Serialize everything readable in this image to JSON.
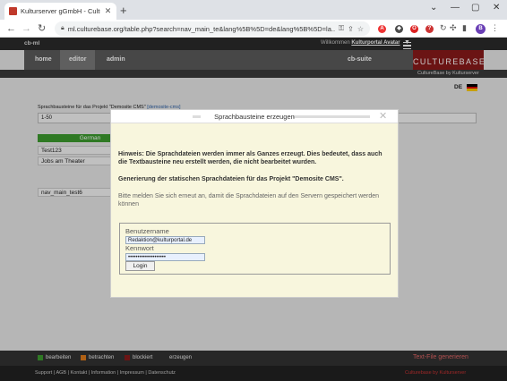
{
  "browser": {
    "tab_title": "Kulturserver gGmbH - Culturebase",
    "tab_close": "✕",
    "new_tab": "+",
    "window_controls": [
      "⌄",
      "—",
      "▢",
      "✕"
    ],
    "nav": {
      "back": "←",
      "forward": "→",
      "reload": "↻"
    },
    "url": "ml.culturebase.org/table.php?search=nav_main_te&lang%5B%5D=de&lang%5B%5D=la...",
    "profile_initial": "B"
  },
  "header": {
    "app_name": "cb-ml",
    "welcome": "Willkommen",
    "user": "Kulturportal Avatar",
    "menu": [
      "home",
      "editor",
      "admin"
    ],
    "suite": "cb-suite",
    "brand": "CULTUREBASE",
    "brand_sub": "CultureBase by Kulturserver",
    "language": "DE",
    "flag_colors": [
      "#000000",
      "#dd0000",
      "#ffce00"
    ]
  },
  "main": {
    "project_title": "Sprachbausteine für das Projekt \"Demosite CMS\"",
    "project_code": "[demosite-cms]",
    "range": "1-50",
    "column_header": "German",
    "rows": [
      "Test123",
      "Jobs am Theater"
    ],
    "stub_key": "nav_main_test6"
  },
  "modal": {
    "title": "Sprachbausteine erzeugen",
    "close": "✕",
    "hint": "Hinweis: Die Sprachdateien werden immer als Ganzes erzeugt. Dies bedeutet, dass auch die Textbausteine neu erstellt werden, die nicht bearbeitet wurden.",
    "generation": "Generierung der statischen Sprachdateien für das Projekt \"Demosite CMS\".",
    "relogin": "Bitte melden Sie sich erneut an, damit die Sprachdateien auf den Servern gespeichert werden können",
    "username_label": "Benutzername",
    "username_value": "Redaktion@kulturportal.de",
    "password_label": "Kennwort",
    "password_value": "••••••••••••••••••••",
    "login_label": "Login"
  },
  "footer": {
    "legend": [
      {
        "label": "bearbeiten",
        "color": "#3d9b2f"
      },
      {
        "label": "betrachten",
        "color": "#e07b1a"
      },
      {
        "label": "blockiert",
        "color": "#8a1a1a"
      },
      {
        "label": "erzeugen",
        "color": "#333333"
      }
    ],
    "generate": "Text-File generieren",
    "links": "Support | AGB | Kontakt | Information | Impressum | Datenschutz",
    "right_text": "Culturebase by Kulturserver"
  }
}
